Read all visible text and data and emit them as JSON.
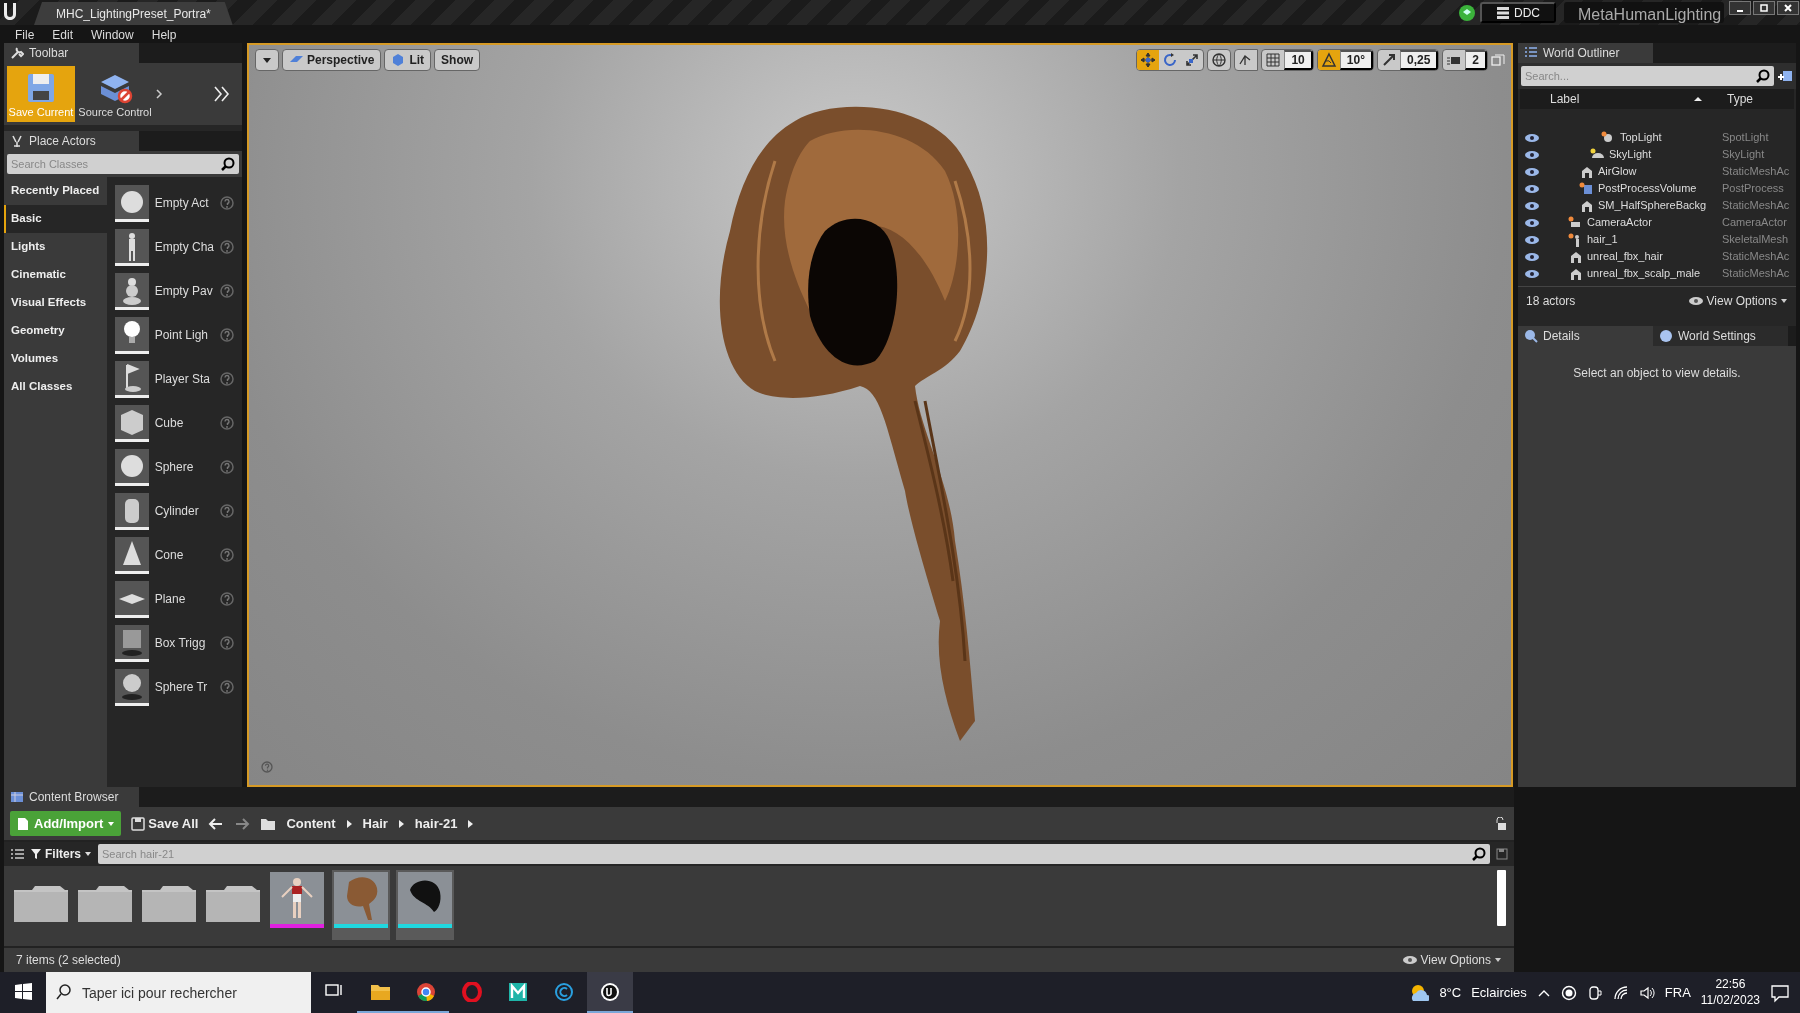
{
  "title_bar": {
    "level_tab": "MHC_LightingPreset_Portra*",
    "ddc_button": "DDC",
    "project_name": "MetaHumanLighting"
  },
  "menu": [
    "File",
    "Edit",
    "Window",
    "Help"
  ],
  "toolbar": {
    "tab": "Toolbar",
    "buttons": [
      {
        "label": "Save Current",
        "kind": "save",
        "selected": true
      },
      {
        "label": "Source Control",
        "kind": "source-control",
        "selected": false
      }
    ]
  },
  "place_actors": {
    "tab": "Place Actors",
    "search": {
      "placeholder": "Search Classes"
    },
    "categories": [
      {
        "label": "Recently Placed",
        "selected": false
      },
      {
        "label": "Basic",
        "selected": true
      },
      {
        "label": "Lights",
        "selected": false
      },
      {
        "label": "Cinematic",
        "selected": false
      },
      {
        "label": "Visual Effects",
        "selected": false
      },
      {
        "label": "Geometry",
        "selected": false
      },
      {
        "label": "Volumes",
        "selected": false
      },
      {
        "label": "All Classes",
        "selected": false
      }
    ],
    "items": [
      {
        "label": "Empty Act",
        "kind": "sphere"
      },
      {
        "label": "Empty Cha",
        "kind": "character"
      },
      {
        "label": "Empty Pav",
        "kind": "pawn"
      },
      {
        "label": "Point Ligh",
        "kind": "bulb"
      },
      {
        "label": "Player Sta",
        "kind": "flag"
      },
      {
        "label": "Cube",
        "kind": "cube"
      },
      {
        "label": "Sphere",
        "kind": "sphere"
      },
      {
        "label": "Cylinder",
        "kind": "cylinder"
      },
      {
        "label": "Cone",
        "kind": "cone"
      },
      {
        "label": "Plane",
        "kind": "plane"
      },
      {
        "label": "Box Trigg",
        "kind": "box-trigger"
      },
      {
        "label": "Sphere Tr",
        "kind": "sphere-trigger"
      }
    ]
  },
  "viewport": {
    "view_buttons": [
      {
        "label": "Perspective",
        "kind": "perspective"
      },
      {
        "label": "Lit",
        "kind": "lit"
      },
      {
        "label": "Show",
        "kind": "plain"
      }
    ],
    "transform_modes": [
      {
        "kind": "translate",
        "selected": true
      },
      {
        "kind": "rotate",
        "selected": false
      },
      {
        "kind": "scale",
        "selected": false
      }
    ],
    "snaps": [
      {
        "kind": "grid",
        "value": "10",
        "on": false
      },
      {
        "kind": "rotation",
        "value": "10°",
        "on": true
      },
      {
        "kind": "scale",
        "value": "0,25",
        "on": false
      },
      {
        "kind": "camera-speed",
        "value": "2"
      }
    ]
  },
  "world_outliner": {
    "tab": "World Outliner",
    "search": {
      "placeholder": "Search..."
    },
    "columns": [
      "Label",
      "Type"
    ],
    "tree": [
      {
        "children": [
          {
            "children": [
              {
                "children": [
                  {
                    "label": "TopLight",
                    "type": "SpotLight",
                    "kind": "light"
                  }
                ]
              },
              {
                "label": "SkyLight",
                "type": "SkyLight",
                "kind": "skylight"
              }
            ]
          },
          {
            "label": "AirGlow",
            "type": "StaticMeshAc",
            "kind": "mesh"
          },
          {
            "label": "PostProcessVolume",
            "type": "PostProcess",
            "kind": "volume"
          },
          {
            "label": "SM_HalfSphereBackg",
            "type": "StaticMeshAc",
            "kind": "mesh"
          }
        ]
      },
      {
        "label": "CameraActor",
        "type": "CameraActor",
        "kind": "camera"
      },
      {
        "label": "hair_1",
        "type": "SkeletalMesh",
        "kind": "skeletal"
      },
      {
        "label": "unreal_fbx_hair",
        "type": "StaticMeshAc",
        "kind": "mesh"
      },
      {
        "label": "unreal_fbx_scalp_male",
        "type": "StaticMeshAc",
        "kind": "mesh"
      }
    ],
    "actor_count": "18 actors",
    "view_options": "View Options"
  },
  "details_panel": {
    "tabs": [
      {
        "label": "Details",
        "selected": true
      },
      {
        "label": "World Settings",
        "selected": false
      }
    ],
    "message": "Select an object to view details."
  },
  "content_browser": {
    "tab": "Content Browser",
    "add_button": "Add/Import",
    "save_all": "Save All",
    "path": [
      "Content",
      "Hair",
      "hair-21"
    ],
    "filters": "Filters",
    "search": {
      "placeholder": "Search hair-21"
    },
    "assets": [
      {
        "kind": "folder",
        "selected": false
      },
      {
        "kind": "folder",
        "selected": false
      },
      {
        "kind": "folder",
        "selected": false
      },
      {
        "kind": "folder",
        "selected": false
      },
      {
        "kind": "character",
        "color": "#e020e0",
        "selected": false
      },
      {
        "kind": "hair",
        "color": "#20d8e0",
        "selected": true
      },
      {
        "kind": "scalp",
        "color": "#20d8e0",
        "selected": true
      }
    ],
    "status": "7 items (2 selected)",
    "view_options": "View Options"
  },
  "taskbar": {
    "search": {
      "placeholder": "Taper ici pour rechercher"
    },
    "apps": [
      {
        "kind": "task-view",
        "running": false,
        "selected": false
      },
      {
        "kind": "explorer",
        "running": true,
        "selected": false
      },
      {
        "kind": "chrome",
        "running": true,
        "selected": false
      },
      {
        "kind": "opera",
        "running": false,
        "selected": false
      },
      {
        "kind": "maya",
        "running": false,
        "selected": false
      },
      {
        "kind": "c-app",
        "running": false,
        "selected": false
      },
      {
        "kind": "unreal",
        "running": true,
        "selected": true
      }
    ],
    "weather": {
      "temperature": "8°C",
      "condition": "Eclaircies"
    },
    "language": "FRA",
    "time": "22:56",
    "date": "11/02/2023"
  }
}
